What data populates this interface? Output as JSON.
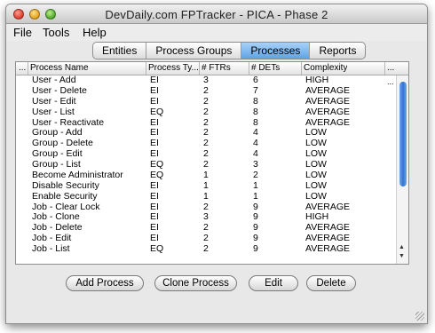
{
  "window": {
    "title": "DevDaily.com FPTracker - PICA - Phase 2"
  },
  "menu": [
    "File",
    "Tools",
    "Help"
  ],
  "tabs": [
    {
      "label": "Entities",
      "active": false
    },
    {
      "label": "Process Groups",
      "active": false
    },
    {
      "label": "Processes",
      "active": true
    },
    {
      "label": "Reports",
      "active": false
    }
  ],
  "table": {
    "corner": "...",
    "columns": [
      "Process Name",
      "Process Ty...",
      "# FTRs",
      "# DETs",
      "Complexity",
      "..."
    ],
    "rows": [
      [
        "User - Add",
        "EI",
        "3",
        "6",
        "HIGH"
      ],
      [
        "User - Delete",
        "EI",
        "2",
        "7",
        "AVERAGE"
      ],
      [
        "User - Edit",
        "EI",
        "2",
        "8",
        "AVERAGE"
      ],
      [
        "User - List",
        "EQ",
        "2",
        "8",
        "AVERAGE"
      ],
      [
        "User - Reactivate",
        "EI",
        "2",
        "8",
        "AVERAGE"
      ],
      [
        "Group - Add",
        "EI",
        "2",
        "4",
        "LOW"
      ],
      [
        "Group - Delete",
        "EI",
        "2",
        "4",
        "LOW"
      ],
      [
        "Group - Edit",
        "EI",
        "2",
        "4",
        "LOW"
      ],
      [
        "Group - List",
        "EQ",
        "2",
        "3",
        "LOW"
      ],
      [
        "Become Administrator",
        "EQ",
        "1",
        "2",
        "LOW"
      ],
      [
        "Disable Security",
        "EI",
        "1",
        "1",
        "LOW"
      ],
      [
        "Enable Security",
        "EI",
        "1",
        "1",
        "LOW"
      ],
      [
        "Job - Clear Lock",
        "EI",
        "2",
        "9",
        "AVERAGE"
      ],
      [
        "Job - Clone",
        "EI",
        "3",
        "9",
        "HIGH"
      ],
      [
        "Job - Delete",
        "EI",
        "2",
        "9",
        "AVERAGE"
      ],
      [
        "Job - Edit",
        "EI",
        "2",
        "9",
        "AVERAGE"
      ],
      [
        "Job - List",
        "EQ",
        "2",
        "9",
        "AVERAGE"
      ]
    ],
    "row_overflow_marker": "..."
  },
  "buttons": {
    "add": "Add Process",
    "clone": "Clone Process",
    "edit": "Edit",
    "delete": "Delete"
  },
  "colors": {
    "selected_tab": "#5ea3e6",
    "scroll_thumb": "#2f75d1"
  }
}
